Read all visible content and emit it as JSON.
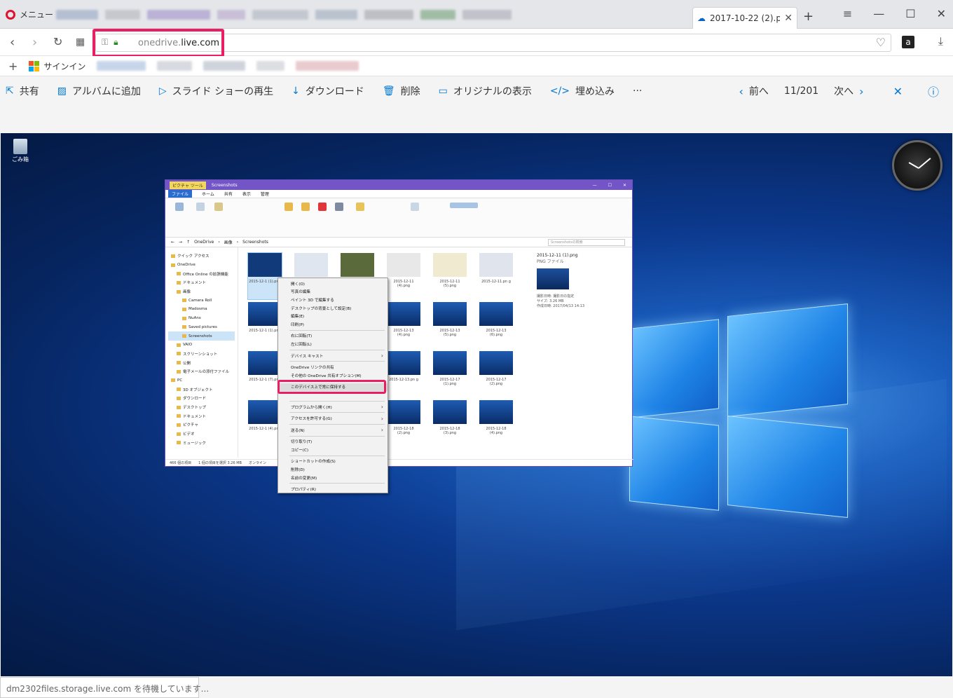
{
  "browser": {
    "menu_label": "メニュー",
    "active_tab_title": "2017-10-22 (2).png",
    "address_prefix": "onedrive.",
    "address_domain": "live.com",
    "signin_label": "サインイン",
    "amazon_label": "a",
    "status_text": "dm2302files.storage.live.com を待機しています..."
  },
  "commands": {
    "share": "共有",
    "add_to_album": "アルバムに追加",
    "slideshow": "スライド ショーの再生",
    "download": "ダウンロード",
    "delete": "削除",
    "original": "オリジナルの表示",
    "embed": "埋め込み",
    "more": "···",
    "prev": "前へ",
    "counter": "11/201",
    "next": "次へ"
  },
  "desktop": {
    "recycle_label": "ごみ箱"
  },
  "explorer": {
    "title_tool": "ピクチャ ツール",
    "title": "Screenshots",
    "tabs": [
      "ファイル",
      "ホーム",
      "共有",
      "表示",
      "管理"
    ],
    "breadcrumb": [
      "OneDrive",
      "画像",
      "Screenshots"
    ],
    "search_placeholder": "Screenshotsの検索",
    "nav": [
      "クイック アクセス",
      "OneDrive",
      "Office Online の拡張機能",
      "ドキュメント",
      "画像",
      "Camera Roll",
      "Madosma",
      "NuAns",
      "Saved pictures",
      "Screenshots",
      "VAIO",
      "スクリーンショット",
      "公開",
      "電子メールの添付ファイル",
      "PC",
      "3D オブジェクト",
      "ダウンロード",
      "デスクトップ",
      "ドキュメント",
      "ピクチャ",
      "ビデオ",
      "ミュージック"
    ],
    "thumbs": [
      "2015-12-1 (1).png",
      "",
      "",
      "2015-12-11 (4).png",
      "2015-12-11 (5).png",
      "2015-12-11.pn g",
      "2015-12-1 (1).png",
      "",
      "",
      "2015-12-13 (4).png",
      "2015-12-13 (5).png",
      "2015-12-13 (6).png",
      "2015-12-1 (7).png",
      "",
      "",
      "2015-12-13.pn g",
      "2015-12-17 (1).png",
      "2015-12-17 (2).png",
      "2015-12-1 (4).png",
      "",
      "",
      "2015-12-18 (2).png",
      "2015-12-18 (3).png",
      "2015-12-18 (4).png"
    ],
    "detail_name": "2015-12-11 (1).png",
    "detail_type": "PNG ファイル",
    "detail_rows": [
      "撮影日時: 撮影日の指定",
      "サイズ: 3.26 MB",
      "作成日時: 2017/04/13 14:13"
    ],
    "status": [
      "466 個の項目",
      "1 個の項目を選択 3.26 MB",
      "オンライン"
    ]
  },
  "context_menu": [
    {
      "label": "開く(O)",
      "sub": false
    },
    {
      "label": "写真の編集",
      "sub": false
    },
    {
      "label": "ペイント 3D で編集する",
      "sub": false
    },
    {
      "label": "デスクトップの背景として設定(B)",
      "sub": false
    },
    {
      "label": "編集(E)",
      "sub": false
    },
    {
      "label": "印刷(P)",
      "sub": false
    },
    {
      "sep": true
    },
    {
      "label": "右に回転(T)",
      "sub": false
    },
    {
      "label": "左に回転(L)",
      "sub": false
    },
    {
      "sep": true
    },
    {
      "label": "デバイス キャスト",
      "sub": true
    },
    {
      "sep": true
    },
    {
      "label": "OneDrive リンクの共有",
      "sub": false
    },
    {
      "label": "その他の OneDrive 共有オプション(M)",
      "sub": false
    },
    {
      "sep": true
    },
    {
      "label": "このデバイス上で常に保持する",
      "sub": false,
      "highlight": true
    },
    {
      "label": "",
      "sub": false
    },
    {
      "sep": true
    },
    {
      "label": "プログラムから開く(H)",
      "sub": true
    },
    {
      "sep": true
    },
    {
      "label": "アクセスを許可する(G)",
      "sub": true
    },
    {
      "sep": true
    },
    {
      "label": "送る(N)",
      "sub": true
    },
    {
      "sep": true
    },
    {
      "label": "切り取り(T)",
      "sub": false
    },
    {
      "label": "コピー(C)",
      "sub": false
    },
    {
      "sep": true
    },
    {
      "label": "ショートカットの作成(S)",
      "sub": false
    },
    {
      "label": "削除(D)",
      "sub": false
    },
    {
      "label": "名前の変更(M)",
      "sub": false
    },
    {
      "sep": true
    },
    {
      "label": "プロパティ(R)",
      "sub": false
    }
  ],
  "colors": {
    "highlight": "#e91e63",
    "accent": "#0078d4",
    "explorer_title": "#7355c8"
  }
}
